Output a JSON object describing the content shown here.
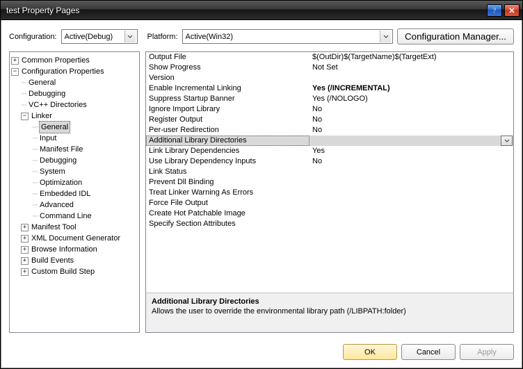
{
  "window": {
    "title": "test Property Pages"
  },
  "toolbar": {
    "config_label": "Configuration:",
    "config_value": "Active(Debug)",
    "platform_label": "Platform:",
    "platform_value": "Active(Win32)",
    "cfgmgr_label": "Configuration Manager..."
  },
  "tree": {
    "n0": "Common Properties",
    "n1": "Configuration Properties",
    "n1_0": "General",
    "n1_1": "Debugging",
    "n1_2": "VC++ Directories",
    "n1_3": "Linker",
    "n1_3_0": "General",
    "n1_3_1": "Input",
    "n1_3_2": "Manifest File",
    "n1_3_3": "Debugging",
    "n1_3_4": "System",
    "n1_3_5": "Optimization",
    "n1_3_6": "Embedded IDL",
    "n1_3_7": "Advanced",
    "n1_3_8": "Command Line",
    "n1_4": "Manifest Tool",
    "n1_5": "XML Document Generator",
    "n1_6": "Browse Information",
    "n1_7": "Build Events",
    "n1_8": "Custom Build Step"
  },
  "grid": {
    "rows": [
      {
        "label": "Output File",
        "value": "$(OutDir)$(TargetName)$(TargetExt)"
      },
      {
        "label": "Show Progress",
        "value": "Not Set"
      },
      {
        "label": "Version",
        "value": ""
      },
      {
        "label": "Enable Incremental Linking",
        "value": "Yes (/INCREMENTAL)",
        "bold": true
      },
      {
        "label": "Suppress Startup Banner",
        "value": "Yes (/NOLOGO)"
      },
      {
        "label": "Ignore Import Library",
        "value": "No"
      },
      {
        "label": "Register Output",
        "value": "No"
      },
      {
        "label": "Per-user Redirection",
        "value": "No"
      },
      {
        "label": "Additional Library Directories",
        "value": "",
        "selected": true
      },
      {
        "label": "Link Library Dependencies",
        "value": "Yes"
      },
      {
        "label": "Use Library Dependency Inputs",
        "value": "No"
      },
      {
        "label": "Link Status",
        "value": ""
      },
      {
        "label": "Prevent Dll Binding",
        "value": ""
      },
      {
        "label": "Treat Linker Warning As Errors",
        "value": ""
      },
      {
        "label": "Force File Output",
        "value": ""
      },
      {
        "label": "Create Hot Patchable Image",
        "value": ""
      },
      {
        "label": "Specify Section Attributes",
        "value": ""
      }
    ]
  },
  "desc": {
    "title": "Additional Library Directories",
    "text": "Allows the user to override the environmental library path (/LIBPATH:folder)"
  },
  "footer": {
    "ok": "OK",
    "cancel": "Cancel",
    "apply": "Apply"
  }
}
